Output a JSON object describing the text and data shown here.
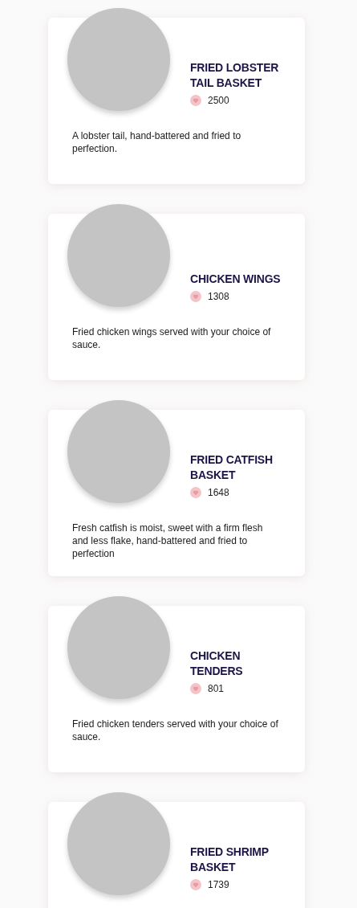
{
  "menu_items": [
    {
      "name": "FRIED LOBSTER TAIL BASKET",
      "likes": "2500",
      "description": "A lobster tail, hand-battered and fried to perfection."
    },
    {
      "name": "CHICKEN WINGS",
      "likes": "1308",
      "description": "Fried chicken wings served with your choice of sauce."
    },
    {
      "name": "FRIED CATFISH BASKET",
      "likes": "1648",
      "description": "Fresh catfish is moist, sweet with a firm flesh and less flake, hand-battered and fried to perfection"
    },
    {
      "name": "CHICKEN TENDERS",
      "likes": "801",
      "description": "Fried chicken tenders served with your choice of sauce."
    },
    {
      "name": "FRIED SHRIMP BASKET",
      "likes": "1739"
    }
  ]
}
